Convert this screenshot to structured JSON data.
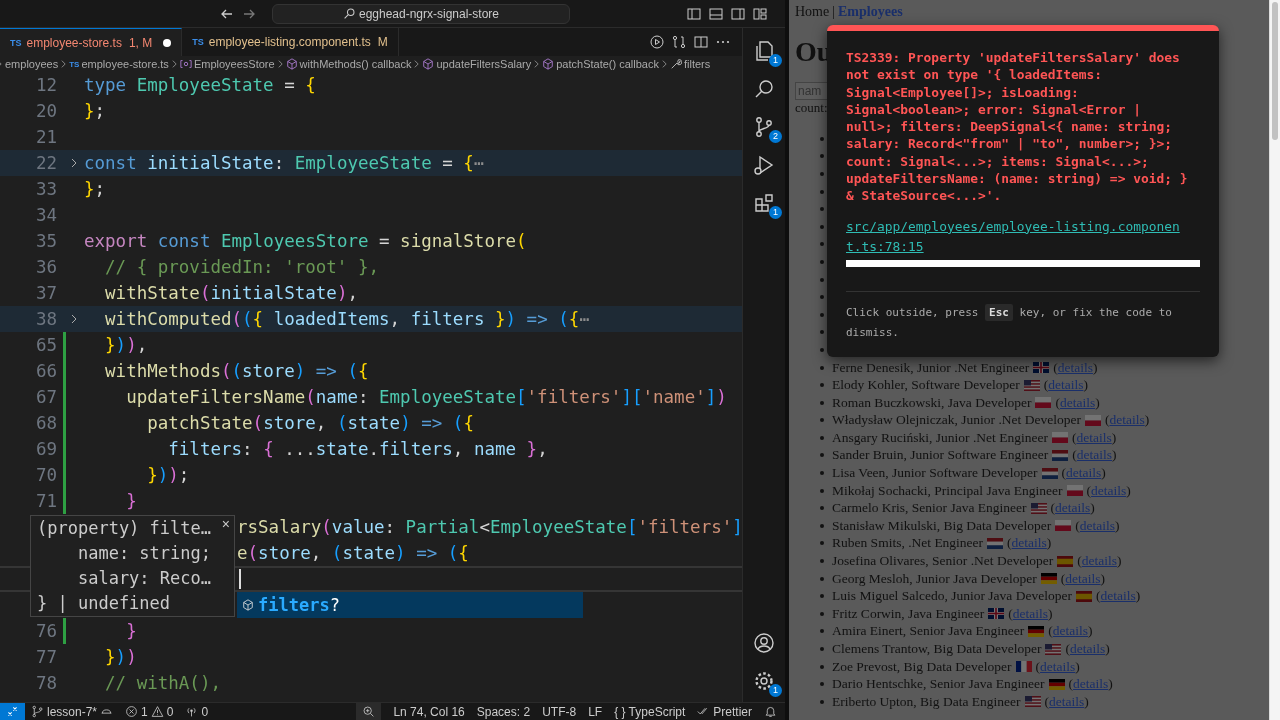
{
  "title_bar": {
    "search": "egghead-ngrx-signal-store"
  },
  "tabs": [
    {
      "file_icon": "TS",
      "label": "employee-store.ts",
      "status": "1, M",
      "kind": "error",
      "dirty": true,
      "selected": true
    },
    {
      "file_icon": "TS",
      "label": "employee-listing.component.ts",
      "status": "M",
      "kind": "modified",
      "dirty": false,
      "selected": false
    }
  ],
  "breadcrumbs": [
    {
      "kind": "folder",
      "label": "employees"
    },
    {
      "kind": "file",
      "icon_text": "TS",
      "label": "employee-store.ts"
    },
    {
      "kind": "variable",
      "label": "EmployeesStore"
    },
    {
      "kind": "method",
      "label": "withMethods() callback"
    },
    {
      "kind": "method",
      "label": "updateFiltersSalary"
    },
    {
      "kind": "method",
      "label": "patchState() callback"
    },
    {
      "kind": "property",
      "label": "filters"
    }
  ],
  "code_lines": [
    {
      "kind": "full",
      "number": "12",
      "folded": false,
      "changed": false,
      "current": false,
      "tokens": [
        {
          "text": "type ",
          "kind": "k"
        },
        {
          "text": "EmployeeState",
          "kind": "t"
        },
        {
          "text": " = ",
          "kind": "p"
        },
        {
          "text": "{",
          "kind": "b1"
        }
      ]
    },
    {
      "kind": "full",
      "number": "20",
      "folded": false,
      "changed": false,
      "current": false,
      "tokens": [
        {
          "text": "}",
          "kind": "b1"
        },
        {
          "text": ";",
          "kind": "p"
        }
      ]
    },
    {
      "kind": "full",
      "number": "21",
      "folded": false,
      "changed": false,
      "current": false
    },
    {
      "kind": "full",
      "number": "22",
      "folded": true,
      "changed": false,
      "current": false,
      "tokens": [
        {
          "text": "const ",
          "kind": "k"
        },
        {
          "text": "initialState",
          "kind": "v"
        },
        {
          "text": ": ",
          "kind": "p"
        },
        {
          "text": "EmployeeState",
          "kind": "t"
        },
        {
          "text": " = ",
          "kind": "p"
        },
        {
          "text": "{",
          "kind": "b1"
        },
        {
          "text": "⋯",
          "kind": "fold"
        }
      ]
    },
    {
      "kind": "full",
      "number": "33",
      "folded": false,
      "changed": false,
      "current": false,
      "tokens": [
        {
          "text": "}",
          "kind": "b1"
        },
        {
          "text": ";",
          "kind": "p"
        }
      ]
    },
    {
      "kind": "full",
      "number": "34",
      "folded": false,
      "changed": false,
      "current": false
    },
    {
      "kind": "full",
      "number": "35",
      "folded": false,
      "changed": false,
      "current": false,
      "tokens": [
        {
          "text": "export ",
          "kind": "x"
        },
        {
          "text": "const ",
          "kind": "k"
        },
        {
          "text": "EmployeesStore",
          "kind": "t"
        },
        {
          "text": " = ",
          "kind": "p"
        },
        {
          "text": "signalStore",
          "kind": "f"
        },
        {
          "text": "(",
          "kind": "b1"
        }
      ]
    },
    {
      "kind": "full",
      "number": "36",
      "folded": false,
      "changed": false,
      "current": false,
      "tokens": [
        {
          "text": "  // { providedIn: 'root' },",
          "kind": "c"
        }
      ]
    },
    {
      "kind": "full",
      "number": "37",
      "folded": false,
      "changed": false,
      "current": false,
      "tokens": [
        {
          "text": "  withState",
          "kind": "f"
        },
        {
          "text": "(",
          "kind": "b2"
        },
        {
          "text": "initialState",
          "kind": "v"
        },
        {
          "text": ")",
          "kind": "b2"
        },
        {
          "text": ",",
          "kind": "p"
        }
      ]
    },
    {
      "kind": "full",
      "number": "38",
      "folded": true,
      "changed": false,
      "current": false,
      "tokens": [
        {
          "text": "  withComputed",
          "kind": "f"
        },
        {
          "text": "(",
          "kind": "b2"
        },
        {
          "text": "(",
          "kind": "b3"
        },
        {
          "text": "{ ",
          "kind": "b1"
        },
        {
          "text": "loadedItems",
          "kind": "v"
        },
        {
          "text": ", ",
          "kind": "p"
        },
        {
          "text": "filters",
          "kind": "v"
        },
        {
          "text": " }",
          "kind": "b1"
        },
        {
          "text": ")",
          "kind": "b3"
        },
        {
          "text": " => ",
          "kind": "k"
        },
        {
          "text": "(",
          "kind": "b3"
        },
        {
          "text": "{",
          "kind": "b1"
        },
        {
          "text": "⋯",
          "kind": "fold"
        }
      ]
    },
    {
      "kind": "full",
      "number": "65",
      "folded": false,
      "changed": true,
      "current": false,
      "tokens": [
        {
          "text": "  }",
          "kind": "b1"
        },
        {
          "text": ")",
          "kind": "b3"
        },
        {
          "text": ")",
          "kind": "b2"
        },
        {
          "text": ",",
          "kind": "p"
        }
      ]
    },
    {
      "kind": "full",
      "number": "66",
      "folded": false,
      "changed": true,
      "current": false,
      "tokens": [
        {
          "text": "  withMethods",
          "kind": "f"
        },
        {
          "text": "(",
          "kind": "b2"
        },
        {
          "text": "(",
          "kind": "b3"
        },
        {
          "text": "store",
          "kind": "v"
        },
        {
          "text": ")",
          "kind": "b3"
        },
        {
          "text": " => ",
          "kind": "k"
        },
        {
          "text": "(",
          "kind": "b3"
        },
        {
          "text": "{",
          "kind": "b1"
        }
      ]
    },
    {
      "kind": "full",
      "number": "67",
      "folded": false,
      "changed": true,
      "current": false,
      "tokens": [
        {
          "text": "    updateFiltersName",
          "kind": "f"
        },
        {
          "text": "(",
          "kind": "b2"
        },
        {
          "text": "name",
          "kind": "v"
        },
        {
          "text": ": ",
          "kind": "p"
        },
        {
          "text": "EmployeeState",
          "kind": "t"
        },
        {
          "text": "[",
          "kind": "b3"
        },
        {
          "text": "'filters'",
          "kind": "s"
        },
        {
          "text": "]",
          "kind": "b3"
        },
        {
          "text": "[",
          "kind": "b3"
        },
        {
          "text": "'name'",
          "kind": "s"
        },
        {
          "text": "]",
          "kind": "b3"
        },
        {
          "text": ")",
          "kind": "b2"
        }
      ]
    },
    {
      "kind": "full",
      "number": "68",
      "folded": false,
      "changed": true,
      "current": false,
      "tokens": [
        {
          "text": "      patchState",
          "kind": "f"
        },
        {
          "text": "(",
          "kind": "b2"
        },
        {
          "text": "store",
          "kind": "v"
        },
        {
          "text": ", ",
          "kind": "p"
        },
        {
          "text": "(",
          "kind": "b3"
        },
        {
          "text": "state",
          "kind": "v"
        },
        {
          "text": ")",
          "kind": "b3"
        },
        {
          "text": " => ",
          "kind": "k"
        },
        {
          "text": "(",
          "kind": "b3"
        },
        {
          "text": "{",
          "kind": "b1"
        }
      ]
    },
    {
      "kind": "full",
      "number": "69",
      "folded": false,
      "changed": true,
      "current": false,
      "tokens": [
        {
          "text": "        filters",
          "kind": "v"
        },
        {
          "text": ": ",
          "kind": "p"
        },
        {
          "text": "{ ",
          "kind": "b2"
        },
        {
          "text": "...",
          "kind": "p"
        },
        {
          "text": "state",
          "kind": "v"
        },
        {
          "text": ".",
          "kind": "p"
        },
        {
          "text": "filters",
          "kind": "v"
        },
        {
          "text": ", ",
          "kind": "p"
        },
        {
          "text": "name",
          "kind": "v"
        },
        {
          "text": " }",
          "kind": "b2"
        },
        {
          "text": ",",
          "kind": "p"
        }
      ]
    },
    {
      "kind": "full",
      "number": "70",
      "folded": false,
      "changed": true,
      "current": false,
      "tokens": [
        {
          "text": "      }",
          "kind": "b1"
        },
        {
          "text": ")",
          "kind": "b3"
        },
        {
          "text": ")",
          "kind": "b2"
        },
        {
          "text": ";",
          "kind": "p"
        }
      ]
    },
    {
      "kind": "full",
      "number": "71",
      "folded": false,
      "changed": true,
      "current": false,
      "tokens": [
        {
          "text": "    }",
          "kind": "b2"
        }
      ]
    },
    {
      "kind": "partial",
      "folded": false,
      "current": false,
      "tokens": [
        {
          "text": "rsSalary",
          "kind": "f"
        },
        {
          "text": "(",
          "kind": "b2"
        },
        {
          "text": "value",
          "kind": "v"
        },
        {
          "text": ": ",
          "kind": "p"
        },
        {
          "text": "Partial",
          "kind": "t"
        },
        {
          "text": "<",
          "kind": "p"
        },
        {
          "text": "EmployeeState",
          "kind": "t"
        },
        {
          "text": "[",
          "kind": "b3"
        },
        {
          "text": "'filters'",
          "kind": "s"
        },
        {
          "text": "]",
          "kind": "b3"
        }
      ]
    },
    {
      "kind": "partial",
      "folded": false,
      "current": false,
      "tokens": [
        {
          "text": "e",
          "kind": "f"
        },
        {
          "text": "(",
          "kind": "b2"
        },
        {
          "text": "store",
          "kind": "v"
        },
        {
          "text": ", ",
          "kind": "p"
        },
        {
          "text": "(",
          "kind": "b3"
        },
        {
          "text": "state",
          "kind": "v"
        },
        {
          "text": ")",
          "kind": "b3"
        },
        {
          "text": " => ",
          "kind": "k"
        },
        {
          "text": "(",
          "kind": "b3"
        },
        {
          "text": "{",
          "kind": "b1"
        }
      ]
    },
    {
      "kind": "partial",
      "folded": false,
      "current": true
    },
    {
      "kind": "covered",
      "folded": false,
      "current": false
    },
    {
      "kind": "full",
      "number": "76",
      "folded": false,
      "changed": true,
      "current": false,
      "tokens": [
        {
          "text": "    }",
          "kind": "b2"
        }
      ]
    },
    {
      "kind": "full",
      "number": "77",
      "folded": false,
      "changed": false,
      "current": false,
      "tokens": [
        {
          "text": "  }",
          "kind": "b1"
        },
        {
          "text": ")",
          "kind": "b3"
        },
        {
          "text": ")",
          "kind": "b2"
        }
      ]
    },
    {
      "kind": "full",
      "number": "78",
      "folded": false,
      "changed": false,
      "current": false,
      "tokens": [
        {
          "text": "  // withA(),",
          "kind": "c"
        }
      ]
    }
  ],
  "hover": {
    "lines": [
      "(property) filte…",
      "    name: string;",
      "    salary: Reco…",
      "} | undefined"
    ],
    "close": "×"
  },
  "suggestion": {
    "label": "**filters**?",
    "selected": true
  },
  "activity_bar": {
    "top": [
      {
        "kind": "explorer",
        "badge": "1"
      },
      {
        "kind": "search"
      },
      {
        "kind": "source-control",
        "badge": "2"
      },
      {
        "kind": "run"
      },
      {
        "kind": "extensions",
        "badge": "1"
      }
    ],
    "bottom": [
      {
        "kind": "account"
      },
      {
        "kind": "settings",
        "badge": "1"
      }
    ]
  },
  "status_bar": {
    "left": [
      {
        "kind": "remote"
      },
      {
        "kind": "branch",
        "text": "lesson-7*"
      },
      {
        "kind": "problems",
        "errors": "1",
        "warnings": "0"
      },
      {
        "kind": "ports",
        "text": "0"
      }
    ],
    "right": [
      {
        "kind": "zoom"
      },
      {
        "kind": "text",
        "text": "Ln 74, Col 16"
      },
      {
        "kind": "text",
        "text": "Spaces: 2"
      },
      {
        "kind": "text",
        "text": "UTF-8"
      },
      {
        "kind": "text",
        "text": "LF"
      },
      {
        "kind": "language",
        "icon": "{ }",
        "text": "TypeScript"
      },
      {
        "kind": "prettier",
        "text": "Prettier"
      },
      {
        "kind": "bell"
      }
    ]
  },
  "browser": {
    "nav": [
      {
        "label": "Home",
        "selected": false
      },
      {
        "label": "Employees",
        "selected": true
      }
    ],
    "nav_separator": "|",
    "heading": "Ou",
    "input_placeholder": "nam",
    "count": "count:",
    "employees": [
      {
        "covered": true
      },
      {
        "covered": true
      },
      {
        "covered": true
      },
      {
        "covered": true
      },
      {
        "covered": true
      },
      {
        "covered": true
      },
      {
        "covered": true
      },
      {
        "covered": true
      },
      {
        "covered": true
      },
      {
        "covered": true
      },
      {
        "covered": true
      },
      {
        "covered": true
      },
      {
        "covered": true
      },
      {
        "covered": false,
        "text": "Ferne Denesik, Junior .Net Engineer",
        "kind": "gb",
        "link": {
          "before": "(",
          "text": "details",
          "after": ")"
        }
      },
      {
        "covered": false,
        "text": "Elody Kohler, Software Developer",
        "kind": "us",
        "link": {
          "before": "(",
          "text": "details",
          "after": ")"
        }
      },
      {
        "covered": false,
        "text": "Roman Buczkowski, Java Developer",
        "kind": "pl",
        "link": {
          "before": "(",
          "text": "details",
          "after": ")"
        }
      },
      {
        "covered": false,
        "text": "Władysław Olejniczak, Junior .Net Developer",
        "kind": "pl",
        "link": {
          "before": "(",
          "text": "details",
          "after": ")"
        }
      },
      {
        "covered": false,
        "text": "Ansgary Ruciński, Junior .Net Engineer",
        "kind": "pl",
        "link": {
          "before": "(",
          "text": "details",
          "after": ")"
        }
      },
      {
        "covered": false,
        "text": "Sander Bruin, Junior Software Engineer",
        "kind": "nl",
        "link": {
          "before": "(",
          "text": "details",
          "after": ")"
        }
      },
      {
        "covered": false,
        "text": "Lisa Veen, Junior Software Developer",
        "kind": "nl",
        "link": {
          "before": "(",
          "text": "details",
          "after": ")"
        }
      },
      {
        "covered": false,
        "text": "Mikołaj Sochacki, Principal Java Engineer",
        "kind": "pl",
        "link": {
          "before": "(",
          "text": "details",
          "after": ")"
        }
      },
      {
        "covered": false,
        "text": "Carmelo Kris, Senior Java Engineer",
        "kind": "us",
        "link": {
          "before": "(",
          "text": "details",
          "after": ")"
        }
      },
      {
        "covered": false,
        "text": "Stanisław Mikulski, Big Data Developer",
        "kind": "pl",
        "link": {
          "before": "(",
          "text": "details",
          "after": ")"
        }
      },
      {
        "covered": false,
        "text": "Ruben Smits, .Net Engineer",
        "kind": "nl",
        "link": {
          "before": "(",
          "text": "details",
          "after": ")"
        }
      },
      {
        "covered": false,
        "text": "Josefina Olivares, Senior .Net Developer",
        "kind": "es",
        "link": {
          "before": "(",
          "text": "details",
          "after": ")"
        }
      },
      {
        "covered": false,
        "text": "Georg Mesloh, Junior Java Developer",
        "kind": "de",
        "link": {
          "before": "(",
          "text": "details",
          "after": ")"
        }
      },
      {
        "covered": false,
        "text": "Luis Miguel Salcedo, Junior Java Developer",
        "kind": "es",
        "link": {
          "before": "(",
          "text": "details",
          "after": ")"
        }
      },
      {
        "covered": false,
        "text": "Fritz Corwin, Java Engineer",
        "kind": "gb",
        "link": {
          "before": "(",
          "text": "details",
          "after": ")"
        }
      },
      {
        "covered": false,
        "text": "Amira Einert, Senior Java Engineer",
        "kind": "de",
        "link": {
          "before": "(",
          "text": "details",
          "after": ")"
        }
      },
      {
        "covered": false,
        "text": "Clemens Trantow, Big Data Developer",
        "kind": "us",
        "link": {
          "before": "(",
          "text": "details",
          "after": ")"
        }
      },
      {
        "covered": false,
        "text": "Zoe Prevost, Big Data Developer",
        "kind": "fr",
        "link": {
          "before": "(",
          "text": "details",
          "after": ")"
        }
      },
      {
        "covered": false,
        "text": "Dario Hentschke, Senior Java Engineer",
        "kind": "de",
        "link": {
          "before": "(",
          "text": "details",
          "after": ")"
        }
      },
      {
        "covered": false,
        "text": "Eriberto Upton, Big Data Engineer",
        "kind": "us",
        "link": {
          "before": "(",
          "text": "details",
          "after": ")"
        }
      }
    ]
  },
  "error_overlay": {
    "message": "TS2339: Property 'updateFiltersSalary' does not exist on type '{ loadedItems: Signal<Employee[]>; isLoading: Signal<boolean>; error: Signal<Error | null>; filters: DeepSignal<{ name: string; salary: Record<\"from\" | \"to\", number>; }>; count: Signal<...>; items: Signal<...>; updateFiltersName: (name: string) => void; } & StateSource<...>'.",
    "file_link": "src/app/employees/employee-listing.component.ts:78:15",
    "hint": {
      "before": "Click outside, press ",
      "key": "Esc",
      "after": " key, or fix the code to dismiss."
    }
  }
}
